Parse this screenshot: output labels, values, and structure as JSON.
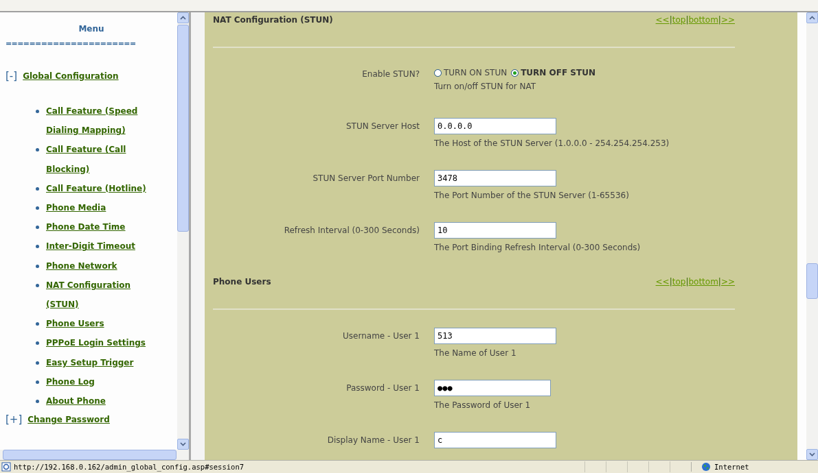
{
  "sidebar": {
    "title": "Menu",
    "divider": "======================",
    "sections": [
      {
        "toggle": "[-]",
        "label": "Global Configuration",
        "children": [
          {
            "label": "Call Feature (Speed Dialing Mapping)"
          },
          {
            "label": "Call Feature (Call Blocking)"
          },
          {
            "label": "Call Feature (Hotline)"
          },
          {
            "label": "Phone Media"
          },
          {
            "label": "Phone Date Time"
          },
          {
            "label": "Inter-Digit Timeout"
          },
          {
            "label": "Phone Network"
          },
          {
            "label": "NAT Configuration (STUN)"
          },
          {
            "label": "Phone Users"
          },
          {
            "label": "PPPoE Login Settings"
          },
          {
            "label": "Easy Setup Trigger"
          },
          {
            "label": "Phone Log"
          },
          {
            "label": "About Phone"
          }
        ]
      },
      {
        "toggle": "[+]",
        "label": "Change Password"
      }
    ]
  },
  "sections": [
    {
      "title": "NAT Configuration (STUN)",
      "nav": [
        {
          "kind": "link",
          "text": "<<"
        },
        {
          "kind": "sep",
          "text": "|"
        },
        {
          "kind": "link",
          "text": "top"
        },
        {
          "kind": "sep",
          "text": "|"
        },
        {
          "kind": "link",
          "text": "bottom"
        },
        {
          "kind": "sep",
          "text": "|"
        },
        {
          "kind": "link",
          "text": ">>"
        }
      ],
      "fields": [
        {
          "kind": "radio",
          "label": "Enable STUN?",
          "options": [
            {
              "label": "TURN ON STUN",
              "selected": false
            },
            {
              "label": "TURN OFF STUN",
              "selected": true
            }
          ],
          "help": "Turn on/off STUN for NAT"
        },
        {
          "kind": "text",
          "label": "STUN Server Host",
          "value": "0.0.0.0",
          "help": "The Host of the STUN Server (1.0.0.0 - 254.254.254.253)"
        },
        {
          "kind": "text",
          "label": "STUN Server Port Number",
          "value": "3478",
          "help": "The Port Number of the STUN Server (1-65536)"
        },
        {
          "kind": "text",
          "label": "Refresh Interval (0-300 Seconds)",
          "value": "10",
          "help": "The Port Binding Refresh Interval (0-300 Seconds)"
        }
      ]
    },
    {
      "title": "Phone Users",
      "nav": [
        {
          "kind": "link",
          "text": "<<"
        },
        {
          "kind": "sep",
          "text": "|"
        },
        {
          "kind": "link",
          "text": "top"
        },
        {
          "kind": "sep",
          "text": "|"
        },
        {
          "kind": "link",
          "text": "bottom"
        },
        {
          "kind": "sep",
          "text": "|"
        },
        {
          "kind": "link",
          "text": ">>"
        }
      ],
      "fields": [
        {
          "kind": "text",
          "label": "Username - User 1",
          "value": "513",
          "help": "The Name of User 1"
        },
        {
          "kind": "password",
          "label": "Password - User 1",
          "value": "●●●",
          "help": "The Password of User 1"
        },
        {
          "kind": "text",
          "label": "Display Name - User 1",
          "value": "c"
        }
      ]
    }
  ],
  "status_bar": {
    "url": "http://192.168.0.162/admin_global_config.asp#session7",
    "zone": "Internet"
  }
}
